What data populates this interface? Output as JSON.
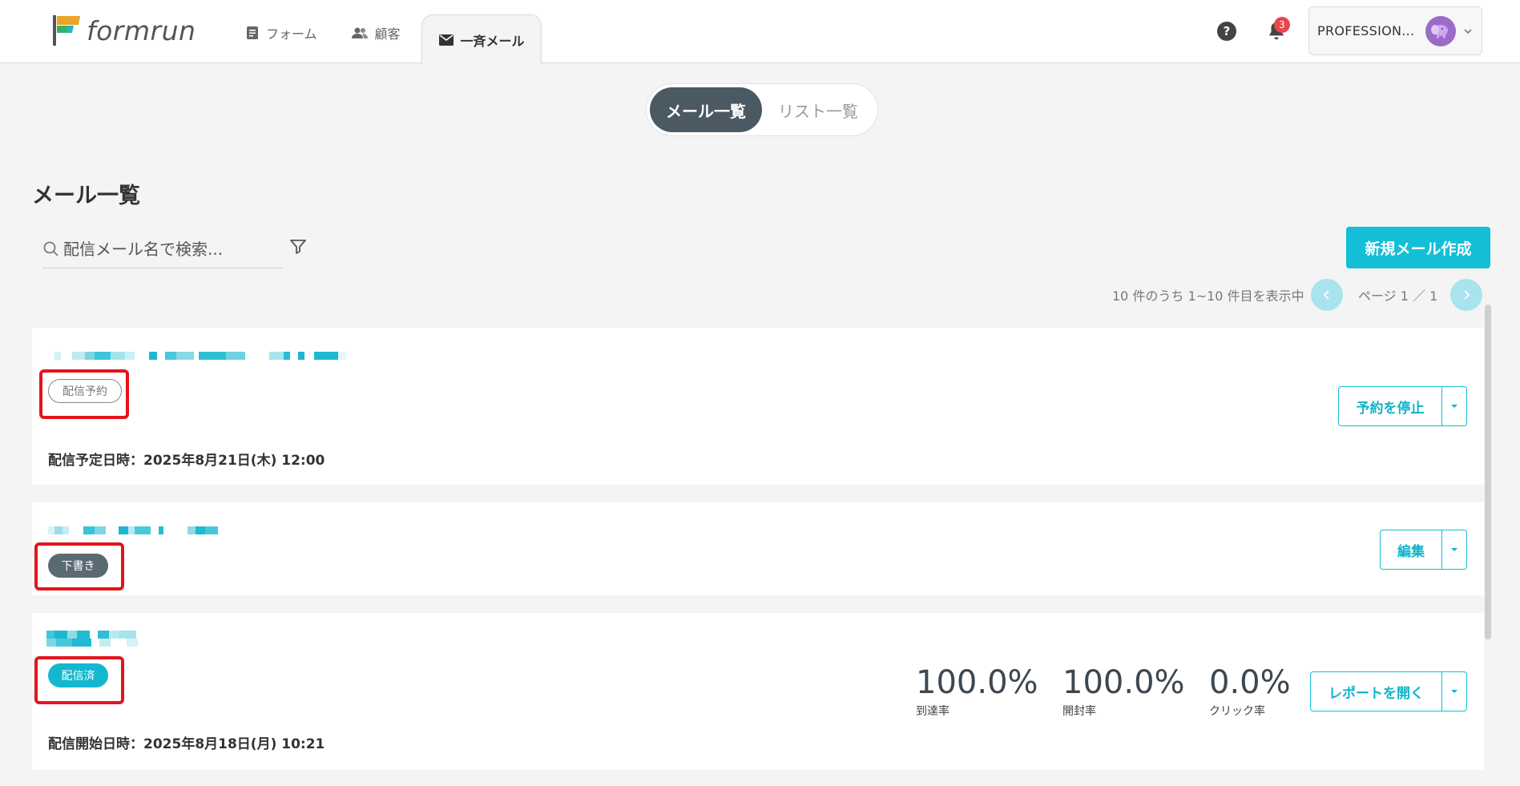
{
  "app": {
    "logo_text": "formrun",
    "nav": [
      {
        "label": "フォーム",
        "icon": "form-icon"
      },
      {
        "label": "顧客",
        "icon": "customers-icon"
      },
      {
        "label": "一斉メール",
        "icon": "mail-icon"
      }
    ],
    "notification_count": "3",
    "account_name": "PROFESSION...",
    "help_label": "?"
  },
  "tabs": {
    "mail_list": "メール一覧",
    "list_list": "リスト一覧"
  },
  "page": {
    "title": "メール一覧",
    "search_placeholder": "配信メール名で検索...",
    "new_button": "新規メール作成",
    "pager_summary": "10 件のうち 1~10 件目を表示中",
    "page_label": "ページ 1 ／ 1"
  },
  "mails": [
    {
      "status": "配信予約",
      "date_line": "配信予定日時：2025年8月21日(木) 12:00",
      "action": "予約を停止"
    },
    {
      "status": "下書き",
      "action": "編集"
    },
    {
      "status": "配信済",
      "date_line": "配信開始日時：2025年8月18日(月) 10:21",
      "action": "レポートを開く",
      "stats": [
        {
          "value": "100.0%",
          "label": "到達率"
        },
        {
          "value": "100.0%",
          "label": "開封率"
        },
        {
          "value": "0.0%",
          "label": "クリック率"
        }
      ]
    }
  ],
  "colors": {
    "accent": "#12bfd6",
    "highlight": "#e4141c",
    "dark": "#4b5963"
  }
}
